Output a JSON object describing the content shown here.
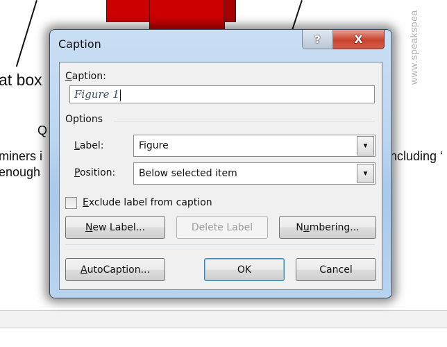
{
  "background": {
    "text_fragments": [
      "at box",
      "Q",
      "miners i",
      "enough",
      "ncluding ‘"
    ],
    "watermark": "www.speakspea"
  },
  "dialog": {
    "title": "Caption",
    "help_label": "?",
    "close_label": "X",
    "caption_field": {
      "label": "Caption:",
      "label_accel": "C",
      "label_rest": "aption:",
      "value": "Figure 1"
    },
    "options_group": {
      "title": "Options",
      "label_field": {
        "label_accel": "L",
        "label_rest": "abel:",
        "selected": "Figure"
      },
      "position_field": {
        "label_accel": "P",
        "label_rest": "osition:",
        "selected": "Below selected item"
      }
    },
    "exclude_checkbox": {
      "label_accel": "E",
      "label_rest": "xclude label from caption",
      "checked": false
    },
    "buttons": {
      "new_label": {
        "accel": "N",
        "rest": "ew Label..."
      },
      "delete_label": "Delete Label",
      "numbering": {
        "pre": "N",
        "accel": "u",
        "rest": "mbering..."
      },
      "autocaption": {
        "accel": "A",
        "rest": "utoCaption..."
      },
      "ok": "OK",
      "cancel": "Cancel"
    },
    "icons": {
      "dropdown": "▼"
    }
  }
}
